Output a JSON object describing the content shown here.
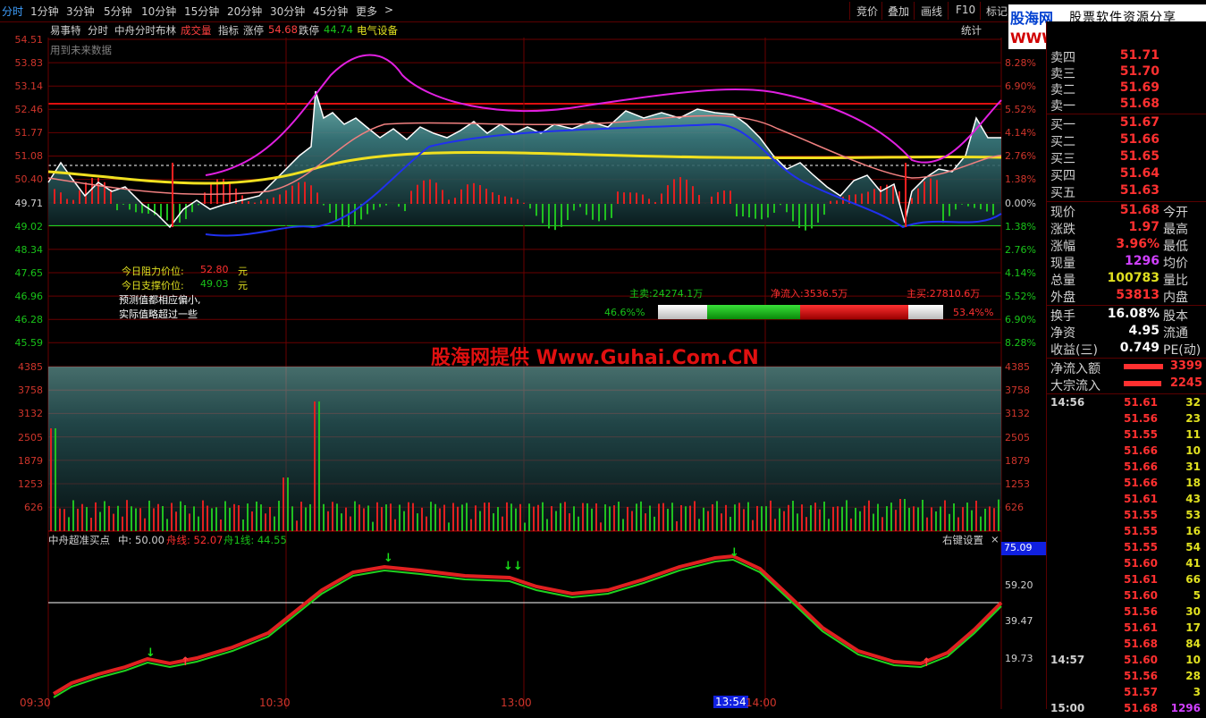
{
  "topbar": {
    "tabs": [
      "分时",
      "1分钟",
      "3分钟",
      "5分钟",
      "10分钟",
      "15分钟",
      "20分钟",
      "30分钟",
      "45分钟",
      "更多"
    ],
    "more_arrow": ">",
    "right_buttons": [
      "竞价",
      "叠加",
      "画线",
      "F10",
      "标记"
    ]
  },
  "logo": {
    "site_cn": "股海网",
    "slogan": "股票软件资源分享",
    "url": "WWW.Guhai.com.cn"
  },
  "header": {
    "items": [
      "易事特",
      "分时",
      "中舟分时布林",
      "成交量",
      "指标",
      "涨停",
      "54.68",
      "跌停",
      "44.74",
      "电气设备"
    ],
    "stats_label": "统计",
    "note": "用到未来数据"
  },
  "price_axis": {
    "left": [
      "54.51",
      "53.83",
      "53.14",
      "52.46",
      "51.77",
      "51.08",
      "50.40",
      "49.71",
      "49.02",
      "48.34",
      "47.65",
      "46.96",
      "46.28",
      "45.59"
    ],
    "right": [
      "8.28%",
      "6.90%",
      "5.52%",
      "4.14%",
      "2.76%",
      "1.38%",
      "0.00%",
      "1.38%",
      "2.76%",
      "4.14%",
      "5.52%",
      "6.90%",
      "8.28%"
    ]
  },
  "volume_axis": [
    "4385",
    "3758",
    "3132",
    "2505",
    "1879",
    "1253",
    "626"
  ],
  "annotations": {
    "resistance_label": "今日阻力价位:",
    "resistance_value": "52.80",
    "resistance_unit": "元",
    "support_label": "今日支撑价位:",
    "support_value": "49.03",
    "support_unit": "元",
    "note1": "预测值都相应偏小,",
    "note2": "实际值略超过一些",
    "main_sell": "主卖:24274.1万",
    "net_inflow": "净流入:3536.5万",
    "main_buy": "主买:27810.6万",
    "sell_pct": "46.6%%",
    "buy_pct": "53.4%%"
  },
  "watermark": "股海网提供 Www.Guhai.Com.CN",
  "indicator": {
    "title": "中舟超准买点",
    "mid_label": "中: 50.00",
    "boat_line": "舟线: 52.07",
    "boat1_line": "舟1线: 44.55",
    "right_setting": "右键设置",
    "close": "×",
    "axis": [
      "75.09",
      "59.20",
      "39.47",
      "19.73"
    ],
    "markers": {
      "down": "↓",
      "down2": "↓↓",
      "up": "↑"
    }
  },
  "time_axis": [
    "09:30",
    "10:30",
    "13:00",
    "13:54",
    "14:00"
  ],
  "quote": {
    "sells": [
      {
        "label": "卖四",
        "price": "51.71"
      },
      {
        "label": "卖三",
        "price": "51.70"
      },
      {
        "label": "卖二",
        "price": "51.69"
      },
      {
        "label": "卖一",
        "price": "51.68"
      }
    ],
    "buys": [
      {
        "label": "买一",
        "price": "51.67"
      },
      {
        "label": "买二",
        "price": "51.66"
      },
      {
        "label": "买三",
        "price": "51.65"
      },
      {
        "label": "买四",
        "price": "51.64"
      },
      {
        "label": "买五",
        "price": "51.63"
      }
    ],
    "stats": [
      {
        "label": "现价",
        "value": "51.68",
        "label2": "今开"
      },
      {
        "label": "涨跌",
        "value": "1.97",
        "label2": "最高"
      },
      {
        "label": "涨幅",
        "value": "3.96%",
        "label2": "最低"
      },
      {
        "label": "现量",
        "value": "1296",
        "label2": "均价"
      },
      {
        "label": "总量",
        "value": "100783",
        "label2": "量比"
      },
      {
        "label": "外盘",
        "value": "53813",
        "label2": "内盘"
      }
    ],
    "extra": [
      {
        "label": "换手",
        "value": "16.08%",
        "label2": "股本"
      },
      {
        "label": "净资",
        "value": "4.95",
        "label2": "流通"
      },
      {
        "label": "收益(三)",
        "value": "0.749",
        "label2": "PE(动)"
      }
    ],
    "flows": [
      {
        "label": "净流入额",
        "value": "3399"
      },
      {
        "label": "大宗流入",
        "value": "2245"
      }
    ]
  },
  "ticks": [
    {
      "time": "14:56",
      "price": "51.61",
      "vol": "32"
    },
    {
      "time": "",
      "price": "51.56",
      "vol": "23"
    },
    {
      "time": "",
      "price": "51.55",
      "vol": "11"
    },
    {
      "time": "",
      "price": "51.66",
      "vol": "10"
    },
    {
      "time": "",
      "price": "51.66",
      "vol": "31"
    },
    {
      "time": "",
      "price": "51.66",
      "vol": "18"
    },
    {
      "time": "",
      "price": "51.61",
      "vol": "43"
    },
    {
      "time": "",
      "price": "51.55",
      "vol": "53"
    },
    {
      "time": "",
      "price": "51.55",
      "vol": "16"
    },
    {
      "time": "",
      "price": "51.55",
      "vol": "54"
    },
    {
      "time": "",
      "price": "51.60",
      "vol": "41"
    },
    {
      "time": "",
      "price": "51.61",
      "vol": "66"
    },
    {
      "time": "",
      "price": "51.60",
      "vol": "5"
    },
    {
      "time": "",
      "price": "51.56",
      "vol": "30"
    },
    {
      "time": "",
      "price": "51.61",
      "vol": "17"
    },
    {
      "time": "",
      "price": "51.68",
      "vol": "84"
    },
    {
      "time": "14:57",
      "price": "51.60",
      "vol": "10"
    },
    {
      "time": "",
      "price": "51.56",
      "vol": "28"
    },
    {
      "time": "",
      "price": "51.57",
      "vol": "3"
    },
    {
      "time": "15:00",
      "price": "51.68",
      "vol": "1296"
    }
  ]
}
